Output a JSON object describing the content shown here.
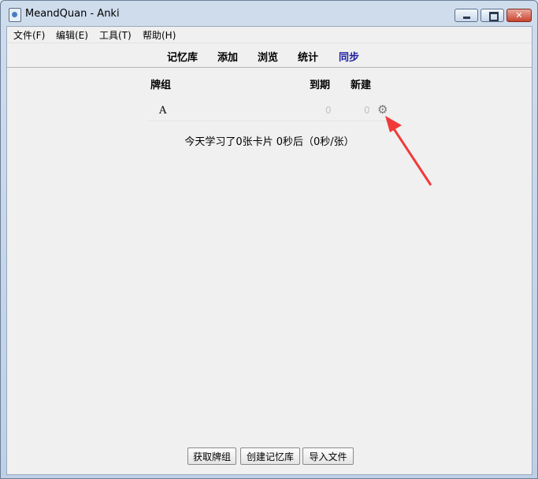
{
  "window": {
    "title": "MeandQuan - Anki"
  },
  "menu": [
    "文件(F)",
    "编辑(E)",
    "工具(T)",
    "帮助(H)"
  ],
  "toolbar": {
    "decks": "记忆库",
    "add": "添加",
    "browse": "浏览",
    "stats": "统计",
    "sync": "同步"
  },
  "deck_table": {
    "col_deck": "牌组",
    "col_due": "到期",
    "col_new": "新建",
    "rows": [
      {
        "name": "A",
        "due": "0",
        "new": "0"
      }
    ]
  },
  "summary": "今天学习了0张卡片 0秒后（0秒/张）",
  "buttons": {
    "get_shared": "获取牌组",
    "create_deck": "创建记忆库",
    "import_file": "导入文件"
  },
  "icons": {
    "gear": "gear-icon",
    "close": "close-icon",
    "minimize": "minimize-icon",
    "maximize": "maximize-icon"
  }
}
